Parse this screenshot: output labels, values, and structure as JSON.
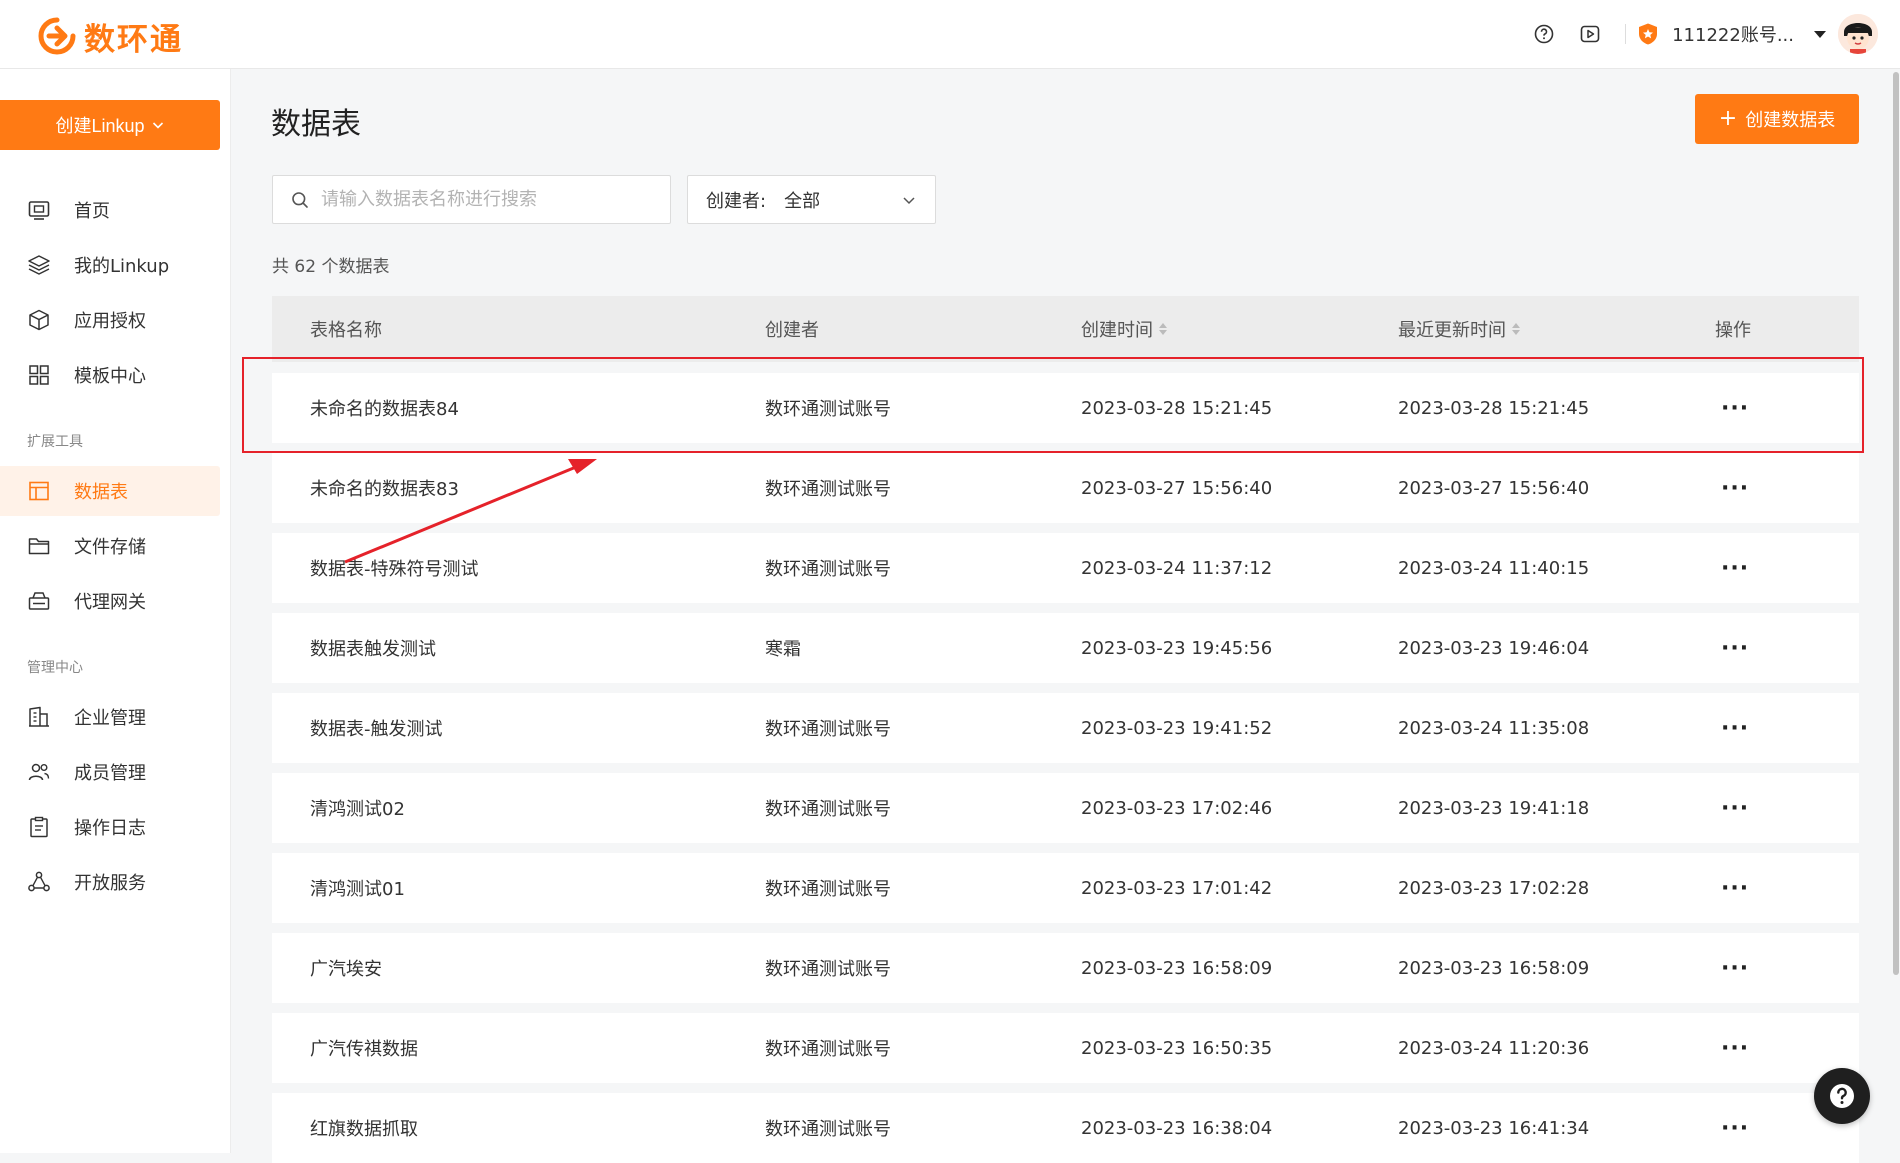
{
  "header": {
    "logo_text": "数环通",
    "account_name": "111222账号...",
    "icons": [
      "help-icon",
      "video-play-icon",
      "vip-badge-icon",
      "user-avatar"
    ]
  },
  "sidebar": {
    "create_button": "创建Linkup",
    "main_items": [
      {
        "label": "首页",
        "icon": "monitor-icon"
      },
      {
        "label": "我的Linkup",
        "icon": "layers-icon"
      },
      {
        "label": "应用授权",
        "icon": "cube-icon"
      },
      {
        "label": "模板中心",
        "icon": "grid-icon"
      }
    ],
    "section_tools": "扩展工具",
    "tool_items": [
      {
        "label": "数据表",
        "icon": "table-icon",
        "active": true
      },
      {
        "label": "文件存储",
        "icon": "folder-icon"
      },
      {
        "label": "代理网关",
        "icon": "gateway-icon"
      }
    ],
    "section_admin": "管理中心",
    "admin_items": [
      {
        "label": "企业管理",
        "icon": "building-icon"
      },
      {
        "label": "成员管理",
        "icon": "users-icon"
      },
      {
        "label": "操作日志",
        "icon": "clipboard-icon"
      },
      {
        "label": "开放服务",
        "icon": "nodes-icon"
      }
    ]
  },
  "main": {
    "title": "数据表",
    "create_button": "创建数据表",
    "search_placeholder": "请输入数据表名称进行搜索",
    "filter_label": "创建者:",
    "filter_value": "全部",
    "count_text": "共 62 个数据表"
  },
  "table": {
    "columns": [
      "表格名称",
      "创建者",
      "创建时间",
      "最近更新时间",
      "操作"
    ],
    "more_label": "···",
    "rows": [
      {
        "name": "未命名的数据表84",
        "creator": "数环通测试账号",
        "created": "2023-03-28 15:21:45",
        "updated": "2023-03-28 15:21:45"
      },
      {
        "name": "未命名的数据表83",
        "creator": "数环通测试账号",
        "created": "2023-03-27 15:56:40",
        "updated": "2023-03-27 15:56:40"
      },
      {
        "name": "数据表-特殊符号测试",
        "creator": "数环通测试账号",
        "created": "2023-03-24 11:37:12",
        "updated": "2023-03-24 11:40:15"
      },
      {
        "name": "数据表触发测试",
        "creator": "寒霜",
        "created": "2023-03-23 19:45:56",
        "updated": "2023-03-23 19:46:04"
      },
      {
        "name": "数据表-触发测试",
        "creator": "数环通测试账号",
        "created": "2023-03-23 19:41:52",
        "updated": "2023-03-24 11:35:08"
      },
      {
        "name": "清鸿测试02",
        "creator": "数环通测试账号",
        "created": "2023-03-23 17:02:46",
        "updated": "2023-03-23 19:41:18"
      },
      {
        "name": "清鸿测试01",
        "creator": "数环通测试账号",
        "created": "2023-03-23 17:01:42",
        "updated": "2023-03-23 17:02:28"
      },
      {
        "name": "广汽埃安",
        "creator": "数环通测试账号",
        "created": "2023-03-23 16:58:09",
        "updated": "2023-03-23 16:58:09"
      },
      {
        "name": "广汽传祺数据",
        "creator": "数环通测试账号",
        "created": "2023-03-23 16:50:35",
        "updated": "2023-03-24 11:20:36"
      },
      {
        "name": "红旗数据抓取",
        "creator": "数环通测试账号",
        "created": "2023-03-23 16:38:04",
        "updated": "2023-03-23 16:41:34"
      }
    ]
  },
  "colors": {
    "accent": "#ff7a14",
    "highlight_box": "#e5222a",
    "active_bg": "#fff2e8",
    "page_bg": "#f5f6f7"
  }
}
